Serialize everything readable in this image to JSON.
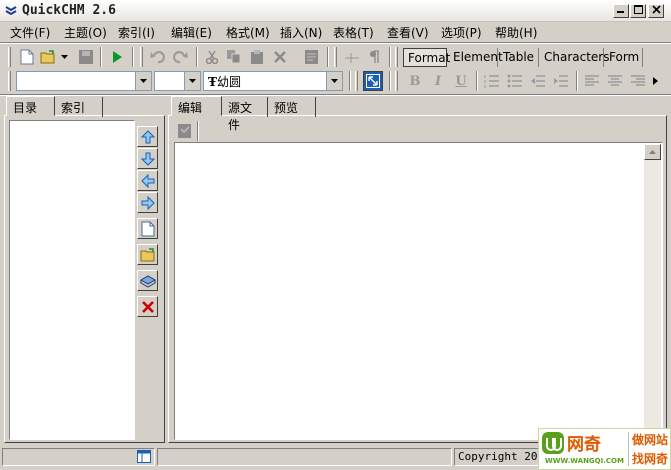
{
  "window": {
    "title": "QuickCHM 2.6"
  },
  "menu": [
    "文件(F)",
    "主题(O)",
    "索引(I)",
    "编辑(E)",
    "格式(M)",
    "插入(N)",
    "表格(T)",
    "查看(V)",
    "选项(P)",
    "帮助(H)"
  ],
  "format_tabs": [
    "Format",
    "Element",
    "Table",
    "Characters",
    "Form"
  ],
  "font_combo": {
    "value": "幼圆",
    "glyph": "Ŧ"
  },
  "left_tabs": [
    "目录",
    "索引"
  ],
  "editor_tabs": [
    "编辑",
    "源文件",
    "预览"
  ],
  "status": {
    "copyright": "Copyright 2001"
  },
  "watermark": {
    "brand": "网奇",
    "url": "WWW.WANGQI.COM",
    "line1": "做网站",
    "line2": "找网奇"
  },
  "colors": {
    "accent_green": "#008000",
    "accent_blue": "#1a5fb4",
    "delete_red": "#cc0000"
  }
}
